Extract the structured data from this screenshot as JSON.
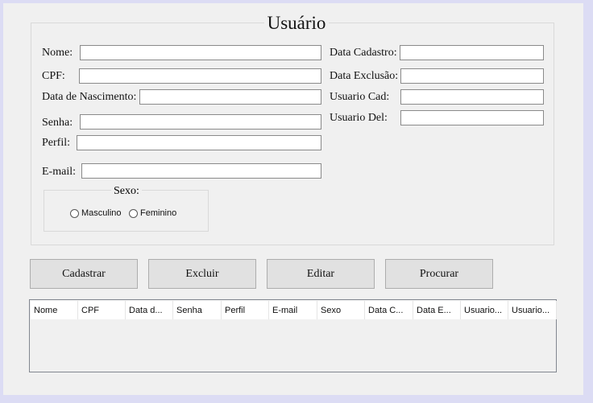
{
  "form": {
    "title": "Usuário",
    "labels": {
      "nome": "Nome:",
      "cpf": "CPF:",
      "nascimento": "Data de Nascimento:",
      "senha": "Senha:",
      "perfil": "Perfil:",
      "email": "E-mail:",
      "data_cadastro": "Data Cadastro:",
      "data_exclusao": "Data Exclusão:",
      "usuario_cad": "Usuario Cad:",
      "usuario_del": "Usuario Del:"
    },
    "values": {
      "nome": "",
      "cpf": "",
      "nascimento": "",
      "senha": "",
      "perfil": "",
      "email": "",
      "data_cadastro": "",
      "data_exclusao": "",
      "usuario_cad": "",
      "usuario_del": ""
    },
    "sexo": {
      "label": "Sexo:",
      "options": [
        "Masculino",
        "Feminino"
      ]
    }
  },
  "buttons": {
    "cadastrar": "Cadastrar",
    "excluir": "Excluir",
    "editar": "Editar",
    "procurar": "Procurar"
  },
  "table": {
    "columns": [
      "Nome",
      "CPF",
      "Data d...",
      "Senha",
      "Perfil",
      "E-mail",
      "Sexo",
      "Data C...",
      "Data E...",
      "Usuario...",
      "Usuario..."
    ],
    "rows": []
  }
}
